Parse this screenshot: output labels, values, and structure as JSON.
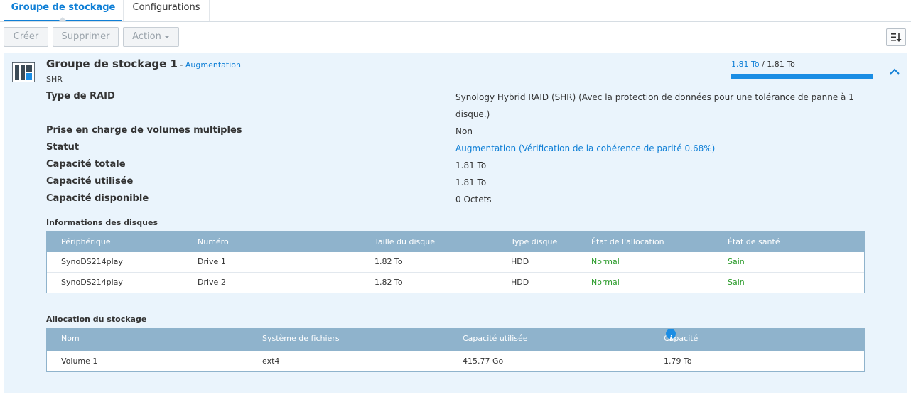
{
  "tabs": [
    {
      "label": "Groupe de stockage",
      "active": true
    },
    {
      "label": "Configurations",
      "active": false
    }
  ],
  "toolbar": {
    "create_label": "Créer",
    "delete_label": "Supprimer",
    "action_label": "Action"
  },
  "pool": {
    "title": "Groupe de stockage 1",
    "separator": " - ",
    "status_link": "Augmentation",
    "subtitle": "SHR",
    "usage_used": "1.81 To",
    "usage_sep": " / ",
    "usage_total": "1.81 To",
    "usage_fraction": 1.0
  },
  "details": [
    {
      "label": "Type de RAID",
      "value": "Synology Hybrid RAID (SHR) (Avec la protection de données pour une tolérance de panne à 1 disque.)"
    },
    {
      "label": "Prise en charge de volumes multiples",
      "value": "Non"
    },
    {
      "label": "Statut",
      "value_link": "Augmentation",
      "value_paren_open": " (",
      "value_link2": "Vérification de la cohérence de parité 0.68%",
      "value_paren_close": ")"
    },
    {
      "label": "Capacité totale",
      "value": "1.81 To"
    },
    {
      "label": "Capacité utilisée",
      "value": "1.81 To"
    },
    {
      "label": "Capacité disponible",
      "value": "0 Octets"
    }
  ],
  "disks": {
    "title": "Informations des disques",
    "columns": [
      "Périphérique",
      "Numéro",
      "Taille du disque",
      "Type disque",
      "État de l'allocation",
      "État de santé"
    ],
    "rows": [
      [
        "SynoDS214play",
        "Drive 1",
        "1.82 To",
        "HDD",
        "Normal",
        "Sain"
      ],
      [
        "SynoDS214play",
        "Drive 2",
        "1.82 To",
        "HDD",
        "Normal",
        "Sain"
      ]
    ]
  },
  "allocation": {
    "title": "Allocation du stockage",
    "columns": [
      "Nom",
      "Système de fichiers",
      "Capacité utilisée",
      "Capacité totale"
    ],
    "rows": [
      [
        "Volume 1",
        "ext4",
        "415.77 Go",
        "1.79 To"
      ]
    ]
  },
  "colors": {
    "accent": "#0f7fd6",
    "panel_bg": "#eaf4fc",
    "grid_header": "#8fb3cc",
    "status_green": "#2a9b2a"
  },
  "icons": [
    "storage-pool-icon",
    "chevron-up-icon",
    "sort-icon",
    "info-icon",
    "caret-down-icon"
  ]
}
